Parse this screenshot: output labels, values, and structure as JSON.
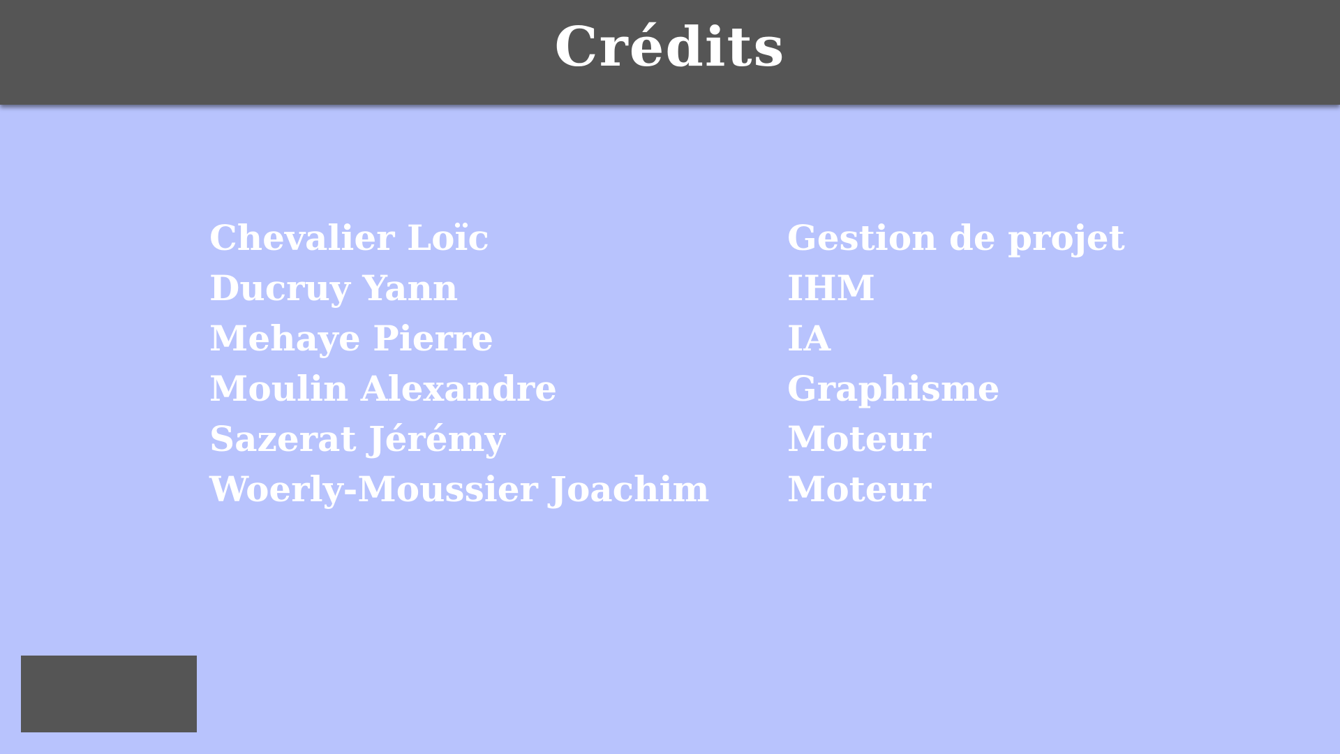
{
  "header": {
    "title": "Crédits"
  },
  "credits": [
    {
      "name": "Chevalier Loïc",
      "role": "Gestion de projet"
    },
    {
      "name": "Ducruy Yann",
      "role": "IHM"
    },
    {
      "name": "Mehaye Pierre",
      "role": "IA"
    },
    {
      "name": "Moulin Alexandre",
      "role": "Graphisme"
    },
    {
      "name": "Sazerat Jérémy",
      "role": "Moteur"
    },
    {
      "name": "Woerly-Moussier Joachim",
      "role": "Moteur"
    }
  ],
  "colors": {
    "background": "#b8c3fd",
    "header": "#555555",
    "text": "#ffffff",
    "button": "#555555"
  }
}
